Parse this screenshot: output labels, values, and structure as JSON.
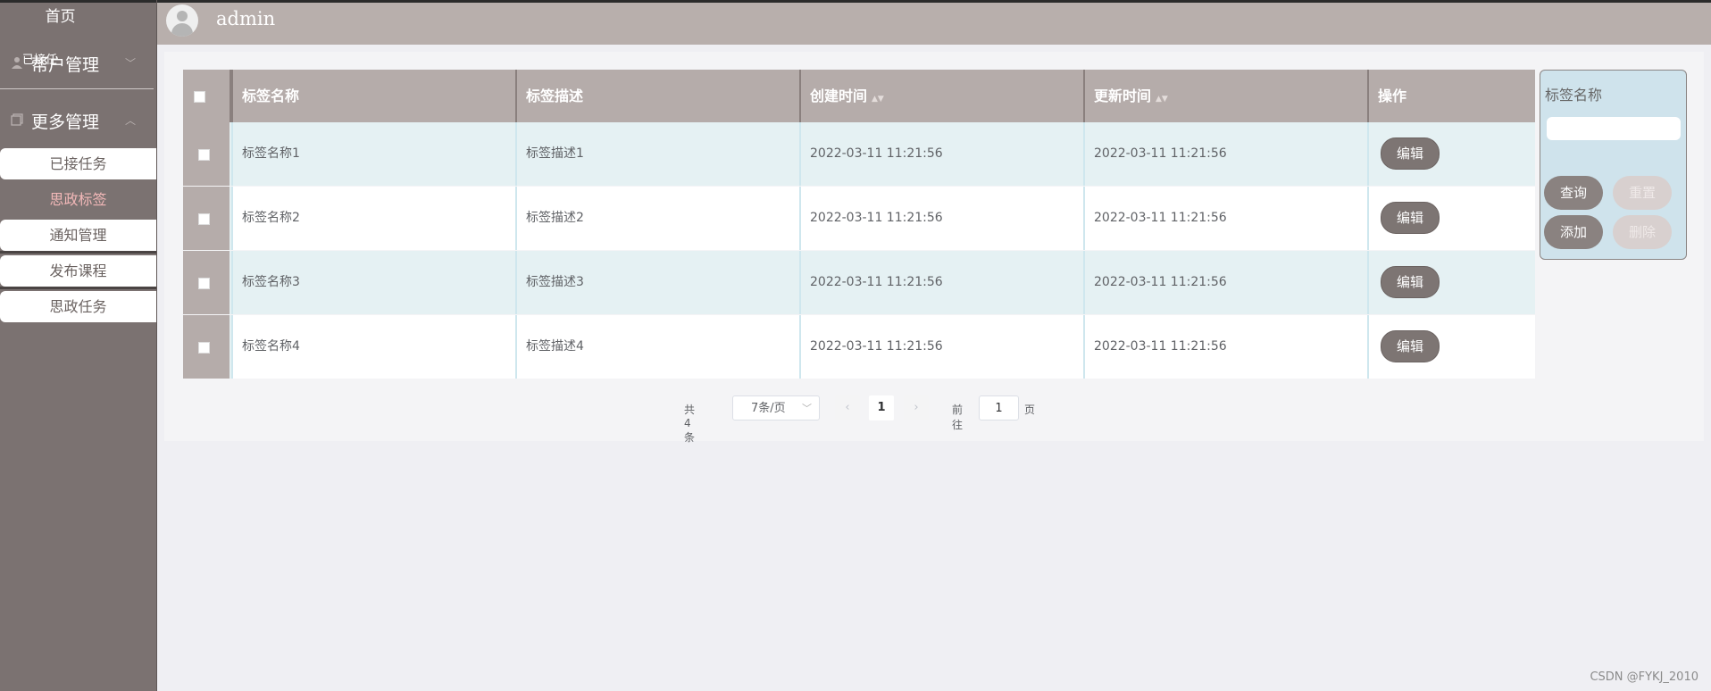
{
  "sidebar": {
    "home": "首页",
    "menus": [
      {
        "label": "帮户管理",
        "overlap_text": "已接任"
      },
      {
        "label": "更多管理"
      }
    ],
    "submenu": [
      "已接任务",
      "思政标签",
      "通知管理",
      "发布课程",
      "思政任务"
    ],
    "active_index": 1
  },
  "header": {
    "username": "admin"
  },
  "table": {
    "columns": [
      "标签名称",
      "标签描述",
      "创建时间",
      "更新时间",
      "操作"
    ],
    "rows": [
      {
        "name": "标签名称1",
        "desc": "标签描述1",
        "created": "2022-03-11 11:21:56",
        "updated": "2022-03-11 11:21:56",
        "action": "编辑"
      },
      {
        "name": "标签名称2",
        "desc": "标签描述2",
        "created": "2022-03-11 11:21:56",
        "updated": "2022-03-11 11:21:56",
        "action": "编辑"
      },
      {
        "name": "标签名称3",
        "desc": "标签描述3",
        "created": "2022-03-11 11:21:56",
        "updated": "2022-03-11 11:21:56",
        "action": "编辑"
      },
      {
        "name": "标签名称4",
        "desc": "标签描述4",
        "created": "2022-03-11 11:21:56",
        "updated": "2022-03-11 11:21:56",
        "action": "编辑"
      }
    ]
  },
  "pagination": {
    "total": "共 4 条",
    "page_size": "7条/页",
    "current": "1",
    "goto_label": "前往",
    "goto_value": "1",
    "page_suffix": "页"
  },
  "search": {
    "label": "标签名称",
    "buttons": {
      "query": "查询",
      "reset": "重置",
      "add": "添加",
      "delete": "删除"
    }
  },
  "watermark": "CSDN @FYKJ_2010"
}
